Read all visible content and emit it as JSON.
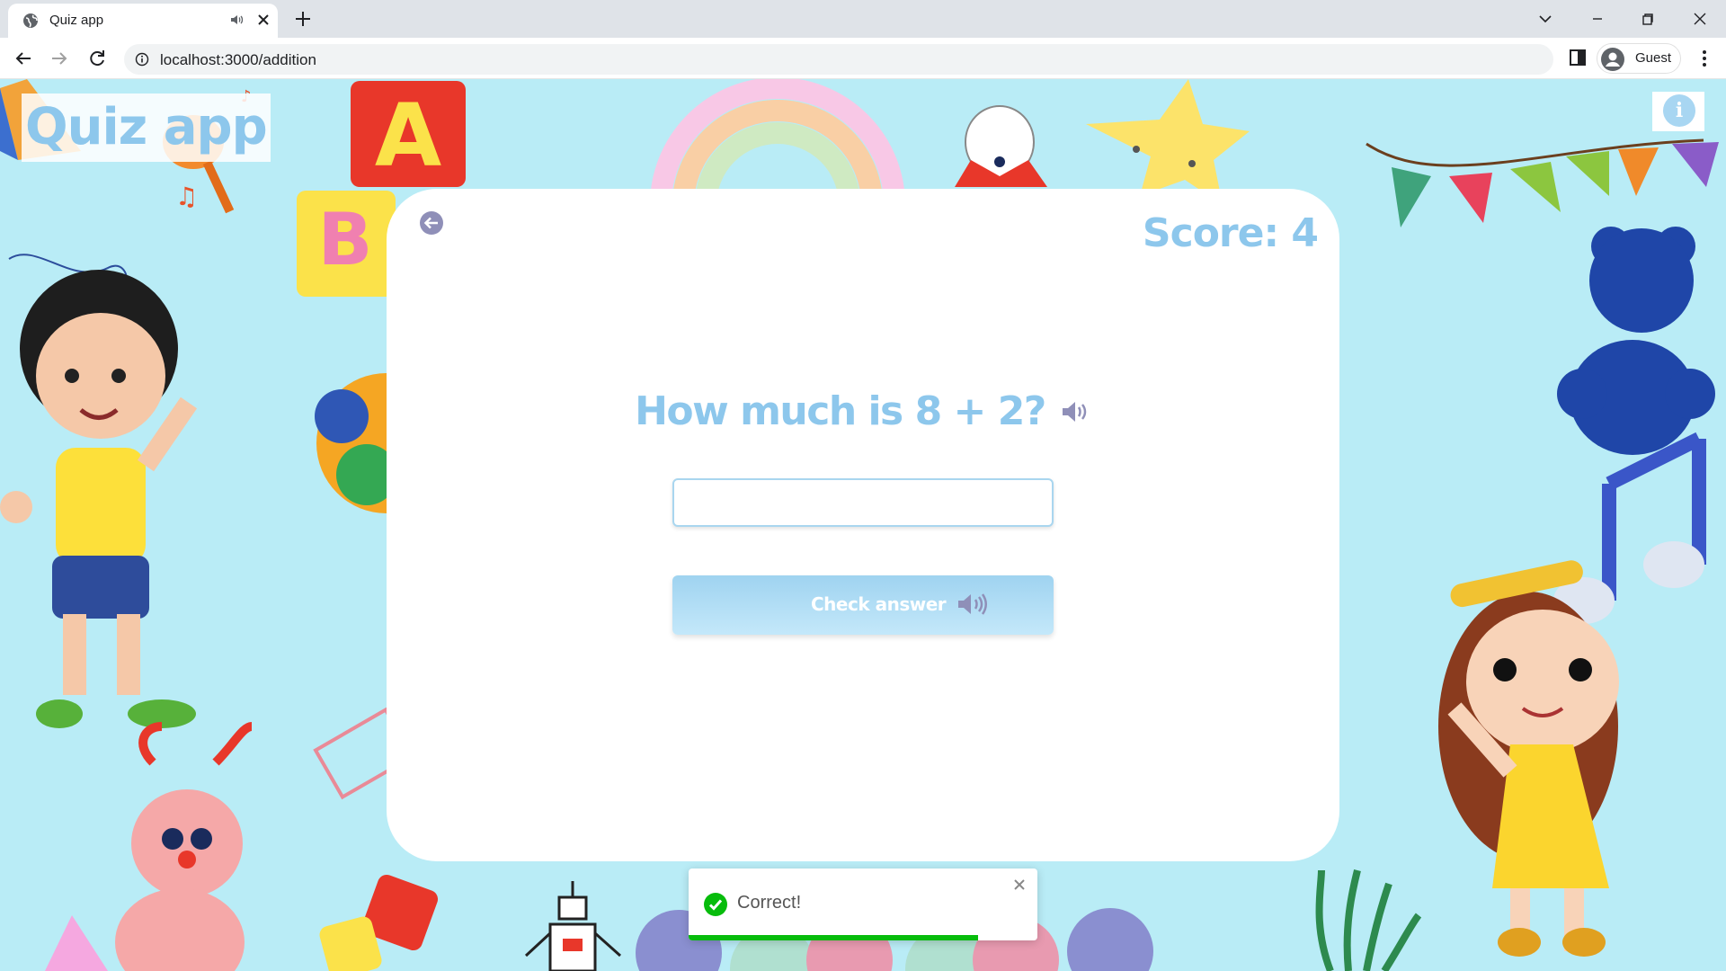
{
  "browser": {
    "tab_title": "Quiz app",
    "url": "localhost:3000/addition",
    "profile_name": "Guest"
  },
  "page": {
    "app_title": "Quiz app",
    "score_text": "Score: 4",
    "question": "How much is 8 + 2?",
    "answer_value": "",
    "check_label": "Check answer"
  },
  "toast": {
    "message": "Correct!",
    "progress": 0.83
  },
  "colors": {
    "background": "#b9ecf6",
    "accent": "#8dc7ec",
    "success": "#07bc0c"
  },
  "icons": [
    "globe-icon",
    "speaker-muted-icon",
    "close-icon",
    "plus-icon",
    "back-arrow-icon",
    "forward-arrow-icon",
    "reload-icon",
    "info-icon",
    "side-panel-icon",
    "avatar-icon",
    "kebab-menu-icon",
    "back-circle-icon",
    "speaker-icon",
    "check-circle-icon"
  ]
}
